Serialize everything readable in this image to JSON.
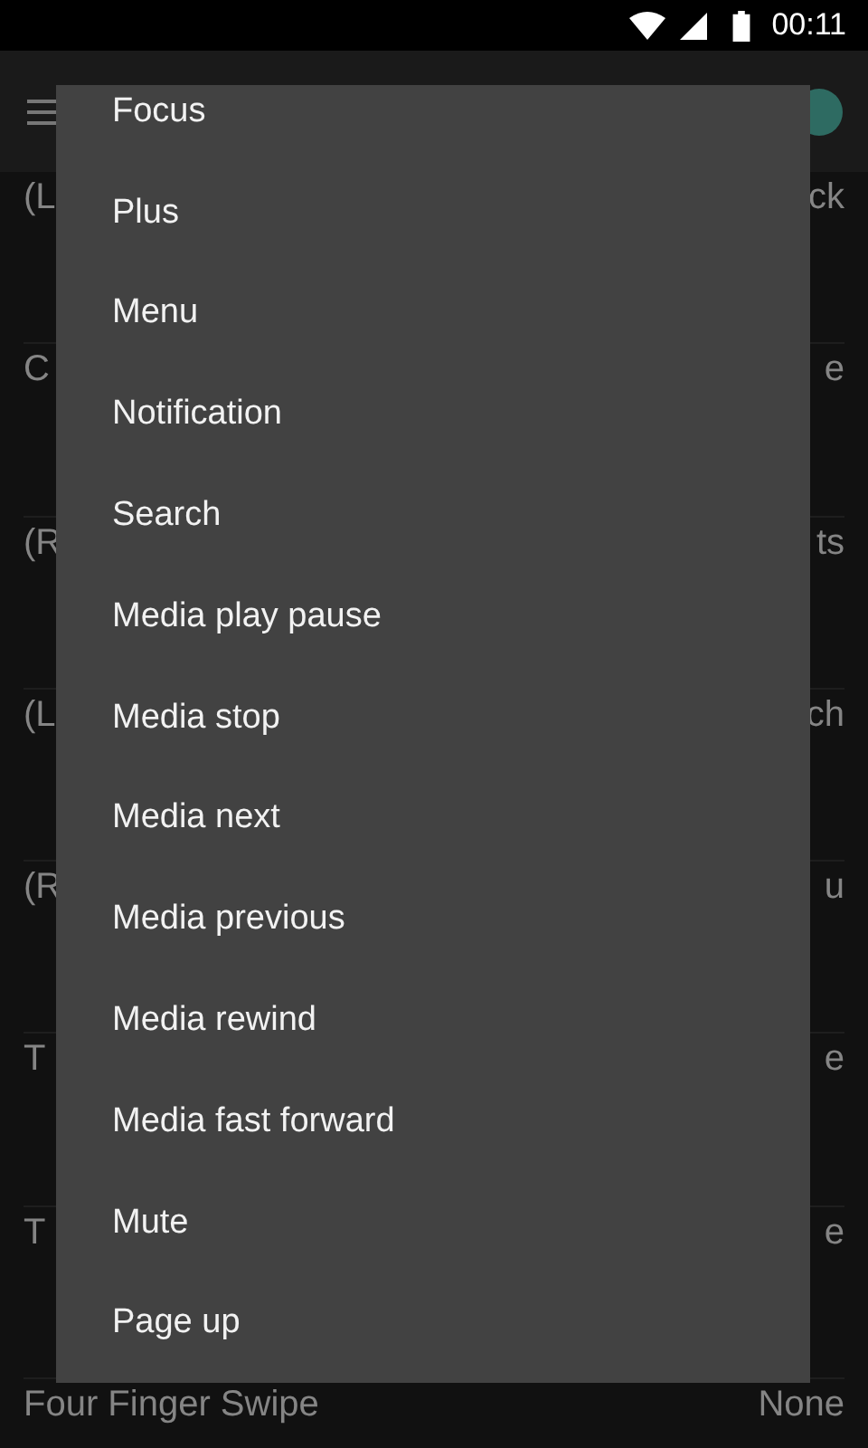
{
  "status_bar": {
    "time": "00:11"
  },
  "app_bar": {
    "switch": {
      "on": true
    }
  },
  "rows": [
    {
      "label": "(L",
      "value": "ck"
    },
    {
      "label": "C",
      "value": "e"
    },
    {
      "label": "(R",
      "value": "ts"
    },
    {
      "label": "(L",
      "value": "ch"
    },
    {
      "label": "(R",
      "value": "u"
    },
    {
      "label": "T",
      "value": "e"
    },
    {
      "label": "T",
      "value": "e"
    },
    {
      "label": "Four Finger Swipe",
      "value": "None"
    }
  ],
  "menu": {
    "items": [
      "Focus",
      "Plus",
      "Menu",
      "Notification",
      "Search",
      "Media play pause",
      "Media stop",
      "Media next",
      "Media previous",
      "Media rewind",
      "Media fast forward",
      "Mute",
      "Page up"
    ]
  }
}
